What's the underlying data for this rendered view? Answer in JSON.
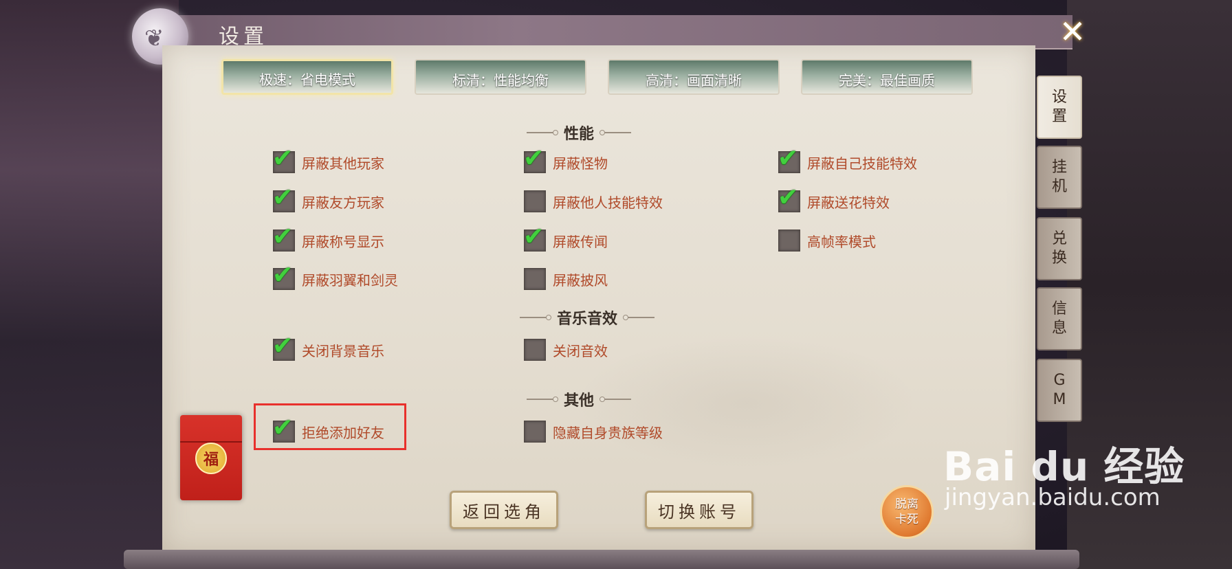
{
  "window": {
    "title": "设置",
    "close_icon": "close-icon"
  },
  "quality_presets": [
    {
      "label": "极速：省电模式",
      "active": true
    },
    {
      "label": "标清：性能均衡",
      "active": false
    },
    {
      "label": "高清：画面清晰",
      "active": false
    },
    {
      "label": "完美：最佳画质",
      "active": false
    }
  ],
  "sections": {
    "performance": "性能",
    "audio": "音乐音效",
    "other": "其他"
  },
  "options": {
    "hide_other_players": {
      "label": "屏蔽其他玩家",
      "checked": true
    },
    "hide_monsters": {
      "label": "屏蔽怪物",
      "checked": true
    },
    "hide_own_skill_effects": {
      "label": "屏蔽自己技能特效",
      "checked": true
    },
    "hide_friendly_players": {
      "label": "屏蔽友方玩家",
      "checked": true
    },
    "hide_others_skill_effects": {
      "label": "屏蔽他人技能特效",
      "checked": false
    },
    "hide_flower_effects": {
      "label": "屏蔽送花特效",
      "checked": true
    },
    "hide_titles": {
      "label": "屏蔽称号显示",
      "checked": true
    },
    "hide_rumors": {
      "label": "屏蔽传闻",
      "checked": true
    },
    "high_fps_mode": {
      "label": "高帧率模式",
      "checked": false
    },
    "hide_wings_sword_spirit": {
      "label": "屏蔽羽翼和剑灵",
      "checked": true
    },
    "hide_cloak": {
      "label": "屏蔽披风",
      "checked": false
    },
    "mute_bgm": {
      "label": "关闭背景音乐",
      "checked": true
    },
    "mute_sfx": {
      "label": "关闭音效",
      "checked": false
    },
    "reject_friend_requests": {
      "label": "拒绝添加好友",
      "checked": true
    },
    "hide_noble_level": {
      "label": "隐藏自身贵族等级",
      "checked": false
    }
  },
  "side_tabs": [
    {
      "label": [
        "设",
        "置"
      ],
      "active": true
    },
    {
      "label": [
        "挂",
        "机"
      ],
      "active": false
    },
    {
      "label": [
        "兑",
        "换"
      ],
      "active": false
    },
    {
      "label": [
        "信",
        "息"
      ],
      "active": false
    },
    {
      "label": [
        "G",
        "M"
      ],
      "active": false
    }
  ],
  "buttons": {
    "back_to_character_select": "返回选角",
    "switch_account": "切换账号"
  },
  "red_envelope": {
    "char": "福"
  },
  "escape_button": {
    "line1": "脱离",
    "line2": "卡死"
  },
  "watermark": {
    "main": "Bai du 经验",
    "url": "jingyan.baidu.com"
  },
  "colors": {
    "option_text": "#b04a2a",
    "check": "#42d03e",
    "highlight_box": "#e8302c"
  }
}
